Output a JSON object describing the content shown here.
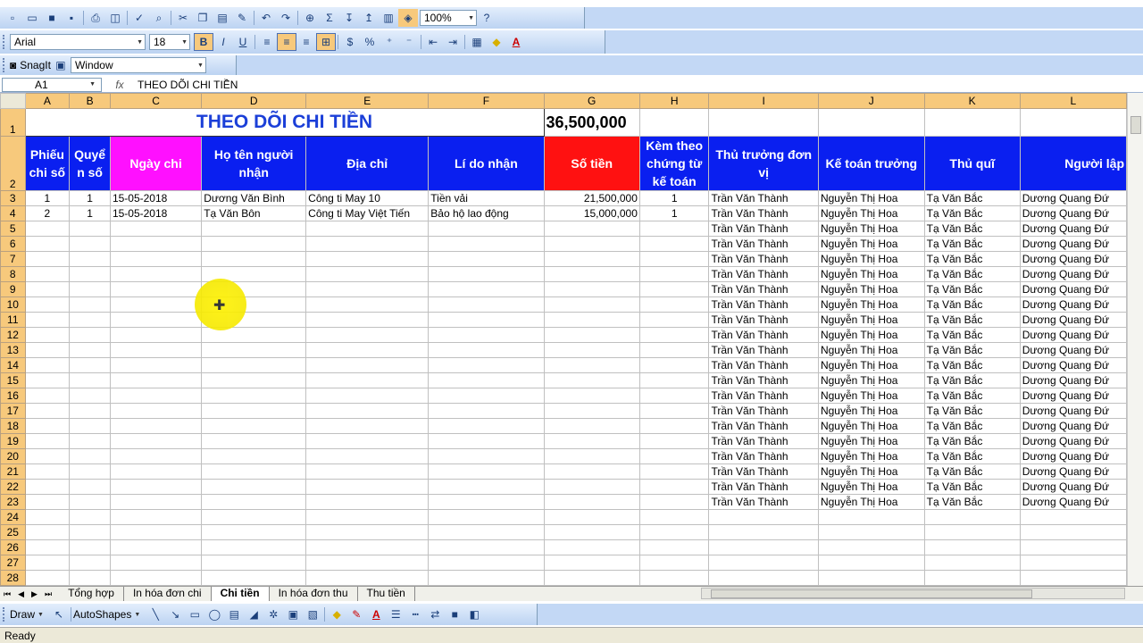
{
  "toolbar": {
    "zoom": "100%",
    "font_name": "Arial",
    "font_size": "18",
    "bold": "B",
    "italic": "I",
    "underline": "U",
    "currency": "$",
    "percent": "%",
    "sigma": "Σ",
    "font_color_label": "A",
    "help": "?"
  },
  "snagit": {
    "label": "SnagIt",
    "window_combo": "Window"
  },
  "formula": {
    "name_box": "A1",
    "fx": "fx",
    "content": "THEO DÕI CHI TIỀN"
  },
  "columns": [
    "A",
    "B",
    "C",
    "D",
    "E",
    "F",
    "G",
    "H",
    "I",
    "J",
    "K",
    "L"
  ],
  "sheet": {
    "title": "THEO DÕI CHI TIỀN",
    "total": "36,500,000",
    "headers": [
      "Phiếu chi số",
      "Quyể n số",
      "Ngày chi",
      "Họ tên người nhận",
      "Địa chỉ",
      "Lí do nhận",
      "Số tiền",
      "Kèm theo chứng từ kế toán",
      "Thủ trưởng đơn vị",
      "Kế toán trưởng",
      "Thủ quĩ",
      "Người lập"
    ],
    "data_rows": [
      [
        "1",
        "1",
        "15-05-2018",
        "Dương Văn Bình",
        "Công ti May 10",
        "Tiền vải",
        "21,500,000",
        "1",
        "Trần Văn Thành",
        "Nguyễn Thị Hoa",
        "Tạ Văn Bắc",
        "Dương Quang Đứ"
      ],
      [
        "2",
        "1",
        "15-05-2018",
        "Tạ Văn Bôn",
        "Công ti May Việt Tiến",
        "Bảo hộ lao động",
        "15,000,000",
        "1",
        "Trần Văn Thành",
        "Nguyễn Thị Hoa",
        "Tạ Văn Bắc",
        "Dương Quang Đứ"
      ]
    ],
    "repeat": {
      "I": "Trần Văn Thành",
      "J": "Nguyễn Thị Hoa",
      "K": "Tạ Văn Bắc",
      "L": "Dương Quang Đứ"
    }
  },
  "tabs": [
    "Tổng hợp",
    "In hóa đơn chi",
    "Chi tiền",
    "In hóa đơn thu",
    "Thu tiền"
  ],
  "active_tab": "Chi tiền",
  "drawbar": {
    "draw": "Draw",
    "autoshapes": "AutoShapes"
  },
  "status": "Ready",
  "colors": {
    "header_blue": "#0a1ff0",
    "header_magenta": "#ff10ff",
    "header_red": "#ff1111",
    "title_blue": "#1b3fd8",
    "cursor_highlight": "#fff200"
  }
}
